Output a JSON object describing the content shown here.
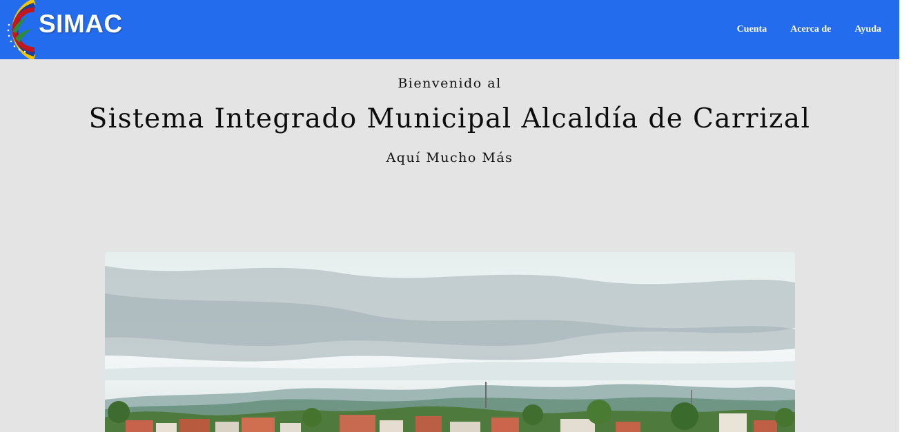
{
  "navbar": {
    "brand": "SIMAC",
    "links": [
      {
        "label": "Cuenta"
      },
      {
        "label": "Acerca de"
      },
      {
        "label": "Ayuda"
      }
    ]
  },
  "hero": {
    "pretitle": "Bienvenido al",
    "title": "Sistema Integrado Municipal Alcaldía de Carrizal",
    "subtitle": "Aquí Mucho Más"
  },
  "colors": {
    "navbar_bg": "#246cee",
    "page_bg": "#e4e4e4",
    "text": "#111111"
  },
  "icons": {
    "logo": "venezuela-arc-emblem-icon"
  }
}
